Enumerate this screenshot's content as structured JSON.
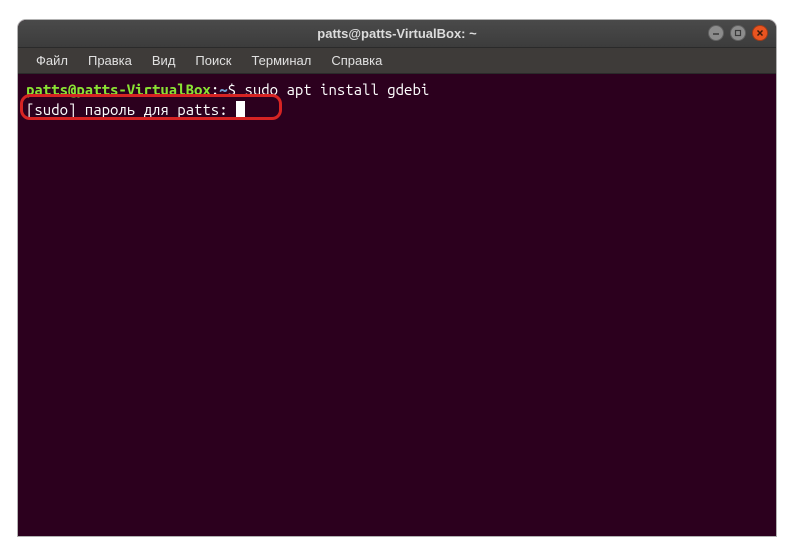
{
  "window": {
    "title": "patts@patts-VirtualBox: ~"
  },
  "menu": {
    "file": "Файл",
    "edit": "Правка",
    "view": "Вид",
    "search": "Поиск",
    "terminal": "Терминал",
    "help": "Справка"
  },
  "terminal": {
    "prompt_user_host": "patts@patts-VirtualBox",
    "colon": ":",
    "prompt_path": "~",
    "prompt_char": "$ ",
    "command": "sudo apt install gdebi",
    "line2": "[sudo] пароль для patts: "
  },
  "colors": {
    "terminal_bg": "#2c001e",
    "close_btn": "#e95420",
    "prompt_green": "#8ae234",
    "path_blue": "#729fcf",
    "highlight": "#d62423"
  }
}
